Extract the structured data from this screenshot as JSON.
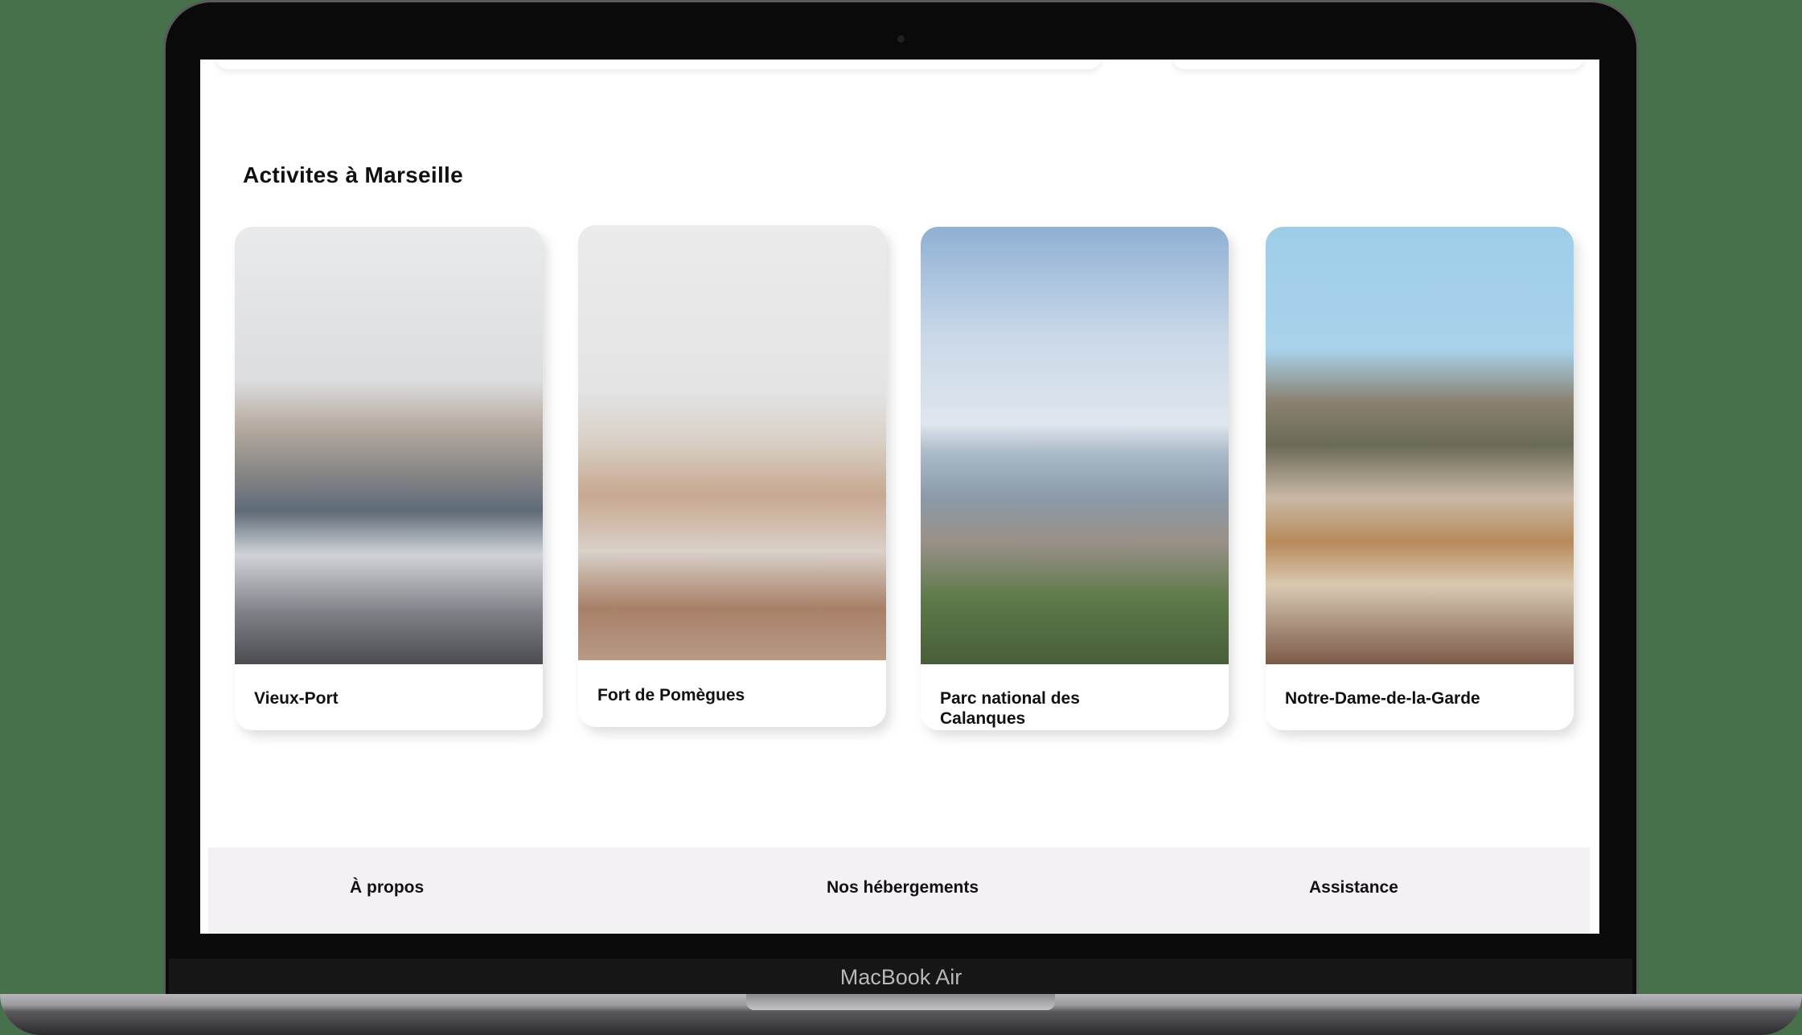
{
  "device": {
    "label": "MacBook Air"
  },
  "section": {
    "title": "Activites à  Marseille"
  },
  "activities": [
    {
      "name": "Vieux-Port",
      "image": "harbor-sailboats"
    },
    {
      "name": "Fort de Pomègues",
      "image": "rocky-fort"
    },
    {
      "name": "Parc national des Calanques",
      "image": "coastal-cliffs"
    },
    {
      "name": "Notre-Dame-de-la-Garde",
      "image": "basilica-hilltop-city"
    }
  ],
  "footer": {
    "columns": [
      {
        "heading": "À propos"
      },
      {
        "heading": "Nos hébergements"
      },
      {
        "heading": "Assistance"
      }
    ]
  },
  "colors": {
    "background": "#47714b",
    "footer_bg": "#f4f1f5"
  }
}
